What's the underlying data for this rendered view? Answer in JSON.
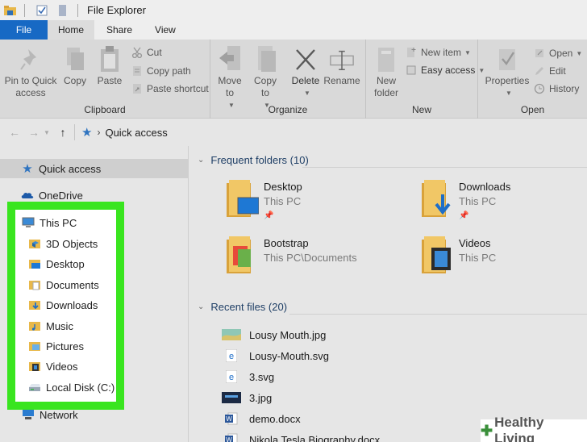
{
  "window": {
    "title": "File Explorer"
  },
  "tabs": [
    {
      "label": "File"
    },
    {
      "label": "Home"
    },
    {
      "label": "Share"
    },
    {
      "label": "View"
    }
  ],
  "ribbon": {
    "clipboard": {
      "label": "Clipboard",
      "pin": "Pin to Quick access",
      "copy": "Copy",
      "paste": "Paste",
      "cut": "Cut",
      "copy_path": "Copy path",
      "paste_shortcut": "Paste shortcut"
    },
    "organize": {
      "label": "Organize",
      "move_to": "Move to",
      "copy_to": "Copy to",
      "delete": "Delete",
      "rename": "Rename"
    },
    "new": {
      "label": "New",
      "new_folder": "New folder",
      "new_item": "New item",
      "easy_access": "Easy access"
    },
    "open": {
      "label": "Open",
      "properties": "Properties",
      "open": "Open",
      "edit": "Edit",
      "history": "History"
    }
  },
  "address": {
    "crumb": "Quick access"
  },
  "nav": {
    "quick_access": "Quick access",
    "onedrive": "OneDrive",
    "this_pc": "This PC",
    "items": [
      {
        "label": "3D Objects"
      },
      {
        "label": "Desktop"
      },
      {
        "label": "Documents"
      },
      {
        "label": "Downloads"
      },
      {
        "label": "Music"
      },
      {
        "label": "Pictures"
      },
      {
        "label": "Videos"
      },
      {
        "label": "Local Disk (C:)"
      }
    ],
    "network": "Network"
  },
  "frequent": {
    "header": "Frequent folders (10)",
    "folders": [
      {
        "name": "Desktop",
        "location": "This PC"
      },
      {
        "name": "Downloads",
        "location": "This PC"
      },
      {
        "name": "Bootstrap",
        "location": "This PC\\Documents"
      },
      {
        "name": "Videos",
        "location": "This PC"
      }
    ]
  },
  "recent": {
    "header": "Recent files (20)",
    "files": [
      {
        "name": "Lousy Mouth.jpg"
      },
      {
        "name": "Lousy-Mouth.svg"
      },
      {
        "name": "3.svg"
      },
      {
        "name": "3.jpg"
      },
      {
        "name": "demo.docx"
      },
      {
        "name": "Nikola Tesla Biography.docx"
      }
    ]
  },
  "watermark": {
    "text": "Healthy Living"
  },
  "colors": {
    "file_tab": "#1769c4",
    "highlight": "#39e51f",
    "folder": "#e8b84a"
  }
}
